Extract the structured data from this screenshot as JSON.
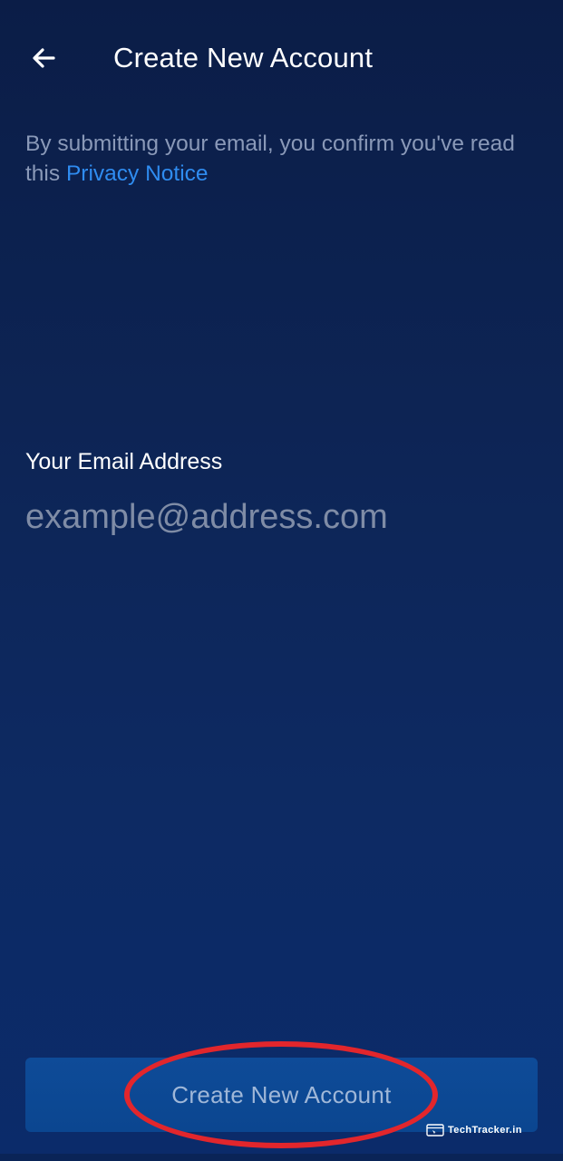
{
  "header": {
    "back_icon": "arrow-left-icon",
    "title": "Create New Account"
  },
  "notice": {
    "text": "By submitting your email, you confirm you've read this ",
    "link_label": "Privacy Notice"
  },
  "email": {
    "label": "Your Email Address",
    "placeholder": "example@address.com",
    "value": ""
  },
  "actions": {
    "create_label": "Create New Account"
  },
  "annotation": {
    "ring_color": "#e2262c"
  },
  "watermark": {
    "text": "TechTracker.in",
    "icon": "browser-window-icon"
  },
  "colors": {
    "background_top": "#0b1d47",
    "background_bottom": "#0b2b6a",
    "link": "#2f8cf0",
    "button": "#0e4b98",
    "muted_text": "#8a99b8"
  }
}
